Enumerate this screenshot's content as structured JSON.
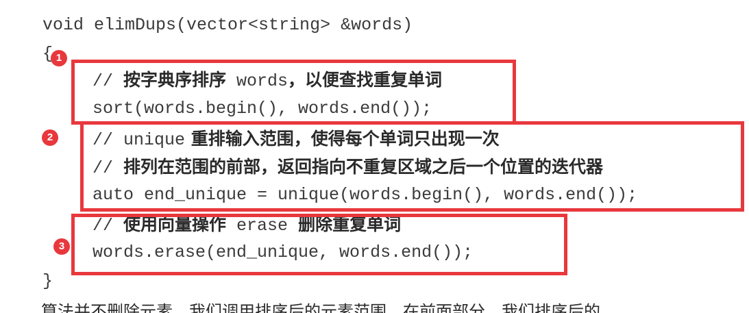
{
  "code": {
    "signature": "void elimDups(vector<string> &words)",
    "open_brace": "{",
    "close_brace": "}",
    "block1": {
      "comment_prefix": "// ",
      "comment_text": "按字典序排序",
      "comment_code": " words",
      "comment_text2": "，以便查找重复单词",
      "statement": "sort(words.begin(), words.end());"
    },
    "block2": {
      "comment1_prefix": "// ",
      "comment1_code": "unique",
      "comment1_text": " 重排输入范围，使得每个单词只出现一次",
      "comment2_prefix": "// ",
      "comment2_text": "排列在范围的前部，返回指向不重复区域之后一个位置的迭代器",
      "statement": "auto end_unique = unique(words.begin(), words.end());"
    },
    "block3": {
      "comment_prefix": "// ",
      "comment_text": "使用向量操作",
      "comment_code": " erase ",
      "comment_text2": "删除重复单词",
      "statement": "words.erase(end_unique, words.end());"
    }
  },
  "markers": {
    "m1": "1",
    "m2": "2",
    "m3": "3"
  },
  "paragraph": {
    "partial_line": "算法并不删除元素。我们调用排序后的元素范围，在前面部分，我们排序后的"
  },
  "colors": {
    "highlight": "#e8383d",
    "text": "#3a3a3a"
  }
}
